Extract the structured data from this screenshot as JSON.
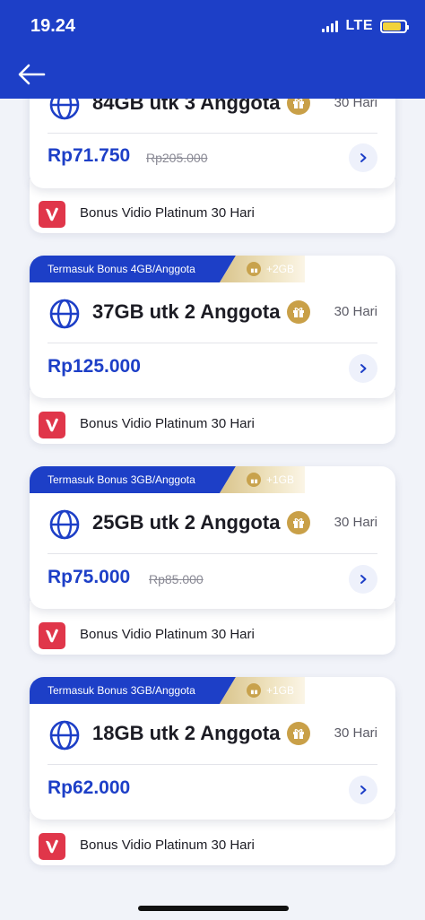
{
  "status_bar": {
    "time": "19.24",
    "network": "LTE",
    "battery_color": "#f2d33c"
  },
  "header": {
    "background": "#1d3fc7",
    "back_icon": "arrow-left-icon"
  },
  "packages": [
    {
      "tag": "",
      "tag_bonus": "",
      "name": "84GB utk 3 Anggota",
      "days": "30 Hari",
      "price": "Rp71.750",
      "old_price": "Rp205.000",
      "bonus": "Bonus Vidio Platinum 30 Hari"
    },
    {
      "tag": "Termasuk Bonus 4GB/Anggota",
      "tag_bonus": "+2GB",
      "name": "37GB utk 2 Anggota",
      "days": "30 Hari",
      "price": "Rp125.000",
      "old_price": "",
      "bonus": "Bonus Vidio Platinum 30 Hari"
    },
    {
      "tag": "Termasuk Bonus 3GB/Anggota",
      "tag_bonus": "+1GB",
      "name": "25GB utk 2 Anggota",
      "days": "30 Hari",
      "price": "Rp75.000",
      "old_price": "Rp85.000",
      "bonus": "Bonus Vidio Platinum 30 Hari"
    },
    {
      "tag": "Termasuk Bonus 3GB/Anggota",
      "tag_bonus": "+1GB",
      "name": "18GB utk 2 Anggota",
      "days": "30 Hari",
      "price": "Rp62.000",
      "old_price": "",
      "bonus": "Bonus Vidio Platinum 30 Hari"
    }
  ],
  "colors": {
    "accent": "#1d3fc7",
    "gift_gold": "#c9a048",
    "vidio_red": "#e0364a"
  }
}
